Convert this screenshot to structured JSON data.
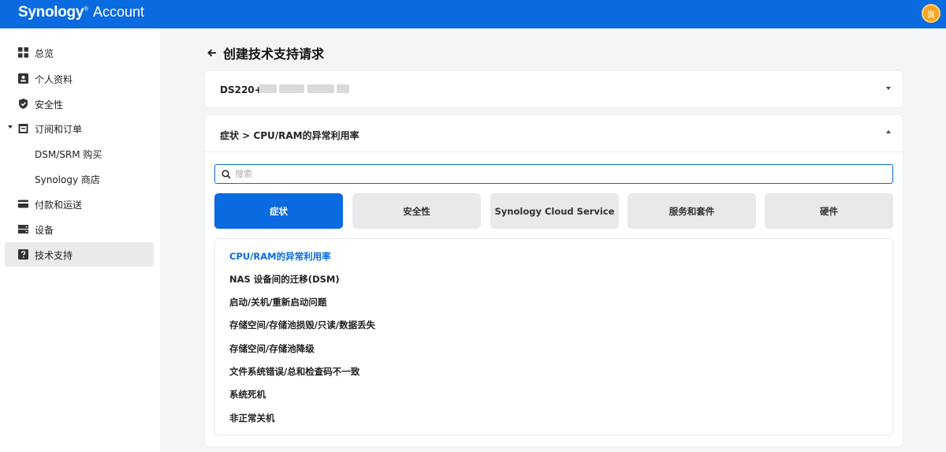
{
  "header": {
    "brand_a": "Synology",
    "brand_mark": "®",
    "app": "Account",
    "avatar_text": "嵩",
    "colors": {
      "bar": "#0a6ae0",
      "avatar": "#f5a623"
    }
  },
  "sidebar": {
    "items": [
      {
        "label": "总览",
        "icon": "grid-icon"
      },
      {
        "label": "个人资料",
        "icon": "profile-card-icon"
      },
      {
        "label": "安全性",
        "icon": "shield-icon"
      },
      {
        "label": "订阅和订单",
        "icon": "calendar-icon",
        "expanded": true
      },
      {
        "label": "DSM/SRM 购买",
        "sub": true
      },
      {
        "label": "Synology 商店",
        "sub": true
      },
      {
        "label": "付款和运送",
        "icon": "credit-card-icon"
      },
      {
        "label": "设备",
        "icon": "server-icon"
      },
      {
        "label": "技术支持",
        "icon": "help-icon",
        "active": true
      }
    ]
  },
  "page": {
    "title": "创建技术支持请求"
  },
  "device": {
    "label": "DS220+"
  },
  "issue": {
    "breadcrumb": "症状 > CPU/RAM的异常利用率",
    "search_placeholder": "搜索",
    "categories": [
      "症状",
      "安全性",
      "Synology Cloud Service",
      "服务和套件",
      "硬件"
    ],
    "active_category": "症状",
    "list": [
      "CPU/RAM的异常利用率",
      "NAS 设备间的迁移(DSM)",
      "启动/关机/重新启动问题",
      "存储空间/存储池损毁/只读/数据丢失",
      "存储空间/存储池降级",
      "文件系统错误/总和检查码不一致",
      "系统死机",
      "非正常关机"
    ],
    "selected": "CPU/RAM的异常利用率"
  }
}
